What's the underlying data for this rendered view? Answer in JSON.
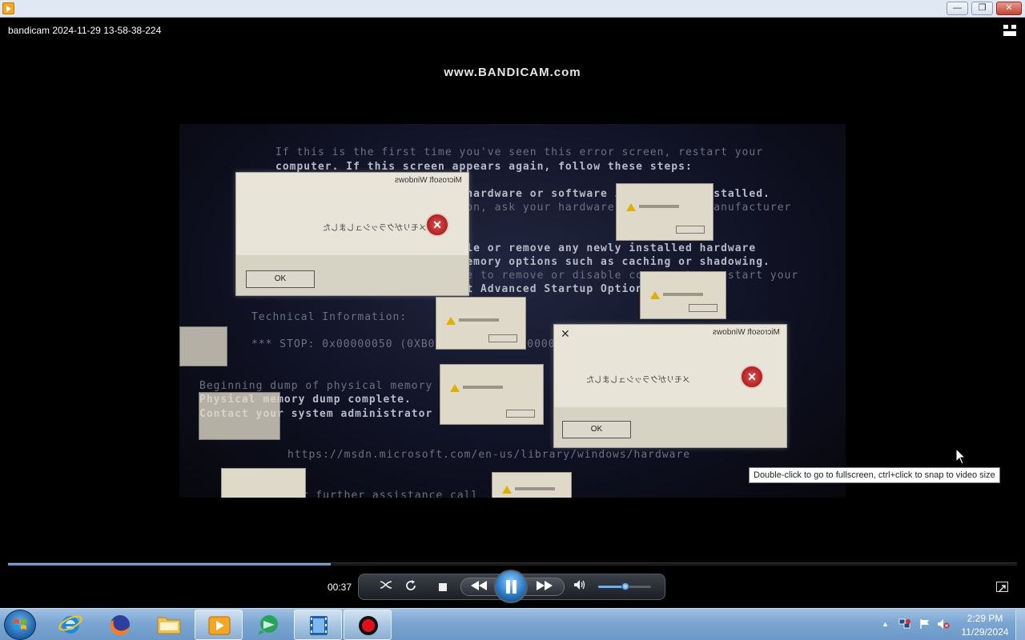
{
  "window": {
    "controls": {
      "minimize": "—",
      "maximize": "❐",
      "close": "✕"
    }
  },
  "player": {
    "file_title": "bandicam 2024-11-29 13-58-38-224",
    "watermark": "www.BANDICAM.com",
    "tooltip": "Double-click to go to fullscreen, ctrl+click to snap to video size",
    "elapsed": "00:37",
    "seek_progress_percent": 32,
    "volume_percent": 52
  },
  "video_frame": {
    "bsod_lines": [
      "If this is the first time you've seen this error screen, restart your",
      "computer. If this screen appears again, follow these steps:",
      "Check to make sure any new hardware or software is properly installed.",
      "If this is a new installation, ask your hardware or software manufacturer",
      "If problems continue, disable or remove any newly installed hardware",
      "or software. Disable BIOS memory options such as caching or shadowing.",
      "If you need to use Safe Mode to remove or disable components, restart your",
      "computer, press F8 to select Advanced Startup Options",
      "Technical Information:",
      "*** STOP: 0x00000050 (0XB07129D0 0x00000000",
      "Beginning dump of physical memory",
      "Physical memory dump complete.",
      "Contact your system administrator",
      "https://msdn.microsoft.com/en-us/library/windows/hardware",
      "for further assistance call"
    ],
    "dialog_title": "Microsoft Windows",
    "dialog_message": "メモリがクラッシュしました",
    "dialog_ok": "OK"
  },
  "taskbar": {
    "clock_time": "2:29 PM",
    "clock_date": "11/29/2024"
  },
  "colors": {
    "accent": "#3f78b5",
    "taskbar": "#7ba6d2",
    "error_red": "#c62828"
  }
}
